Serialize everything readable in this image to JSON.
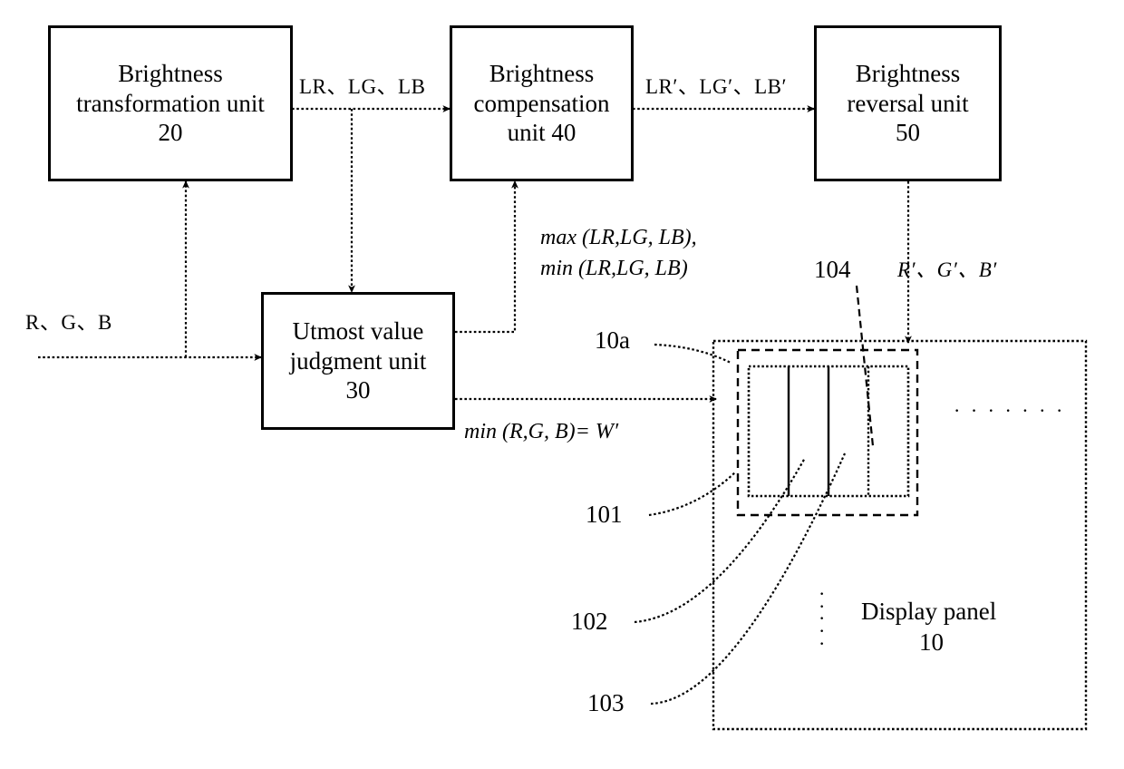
{
  "figure": {
    "type": "patent-block-diagram",
    "background": "#ffffff",
    "ink": "#000000"
  },
  "blocks": {
    "transformation_unit": "Brightness\ntransformation unit\n20",
    "compensation_unit": "Brightness\ncompensation\nunit 40",
    "reversal_unit": "Brightness\nreversal unit\n50",
    "judgment_unit": "Utmost value\njudgment unit\n30"
  },
  "signals": {
    "rgb_input": "R、G、B",
    "l_rgb": "LR、LG、LB",
    "l_rgb_prime": "LR′、LG′、LB′",
    "rgb_prime": "R′、G′、B′",
    "minmax_line1": "max (LR,LG, LB),",
    "minmax_line2": "min (LR,LG, LB)",
    "min_w": "min (R,G, B)= W′"
  },
  "panel": {
    "title_line1": "Display panel",
    "title_line2": "10",
    "dots_horizontal": "· · · · · · ·",
    "dots_vertical": "·\n·\n·\n·\n·"
  },
  "reference_numerals": {
    "panel_subregion": "10a",
    "subpixel_101": "101",
    "subpixel_102": "102",
    "subpixel_103": "103",
    "subpixel_104": "104"
  }
}
